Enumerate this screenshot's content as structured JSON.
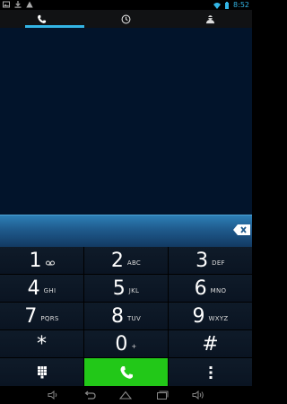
{
  "status_bar": {
    "time": "8:52",
    "left_icons": [
      "picture-icon",
      "download-icon",
      "warning-icon"
    ],
    "right_icons": [
      "wifi-icon",
      "battery-icon"
    ]
  },
  "tabs": [
    {
      "icon": "phone-icon",
      "active": true
    },
    {
      "icon": "clock-icon",
      "active": false
    },
    {
      "icon": "contacts-icon",
      "active": false
    }
  ],
  "number_field": {
    "value": ""
  },
  "keypad": [
    {
      "digit": "1",
      "letters": "",
      "voicemail": true
    },
    {
      "digit": "2",
      "letters": "ABC"
    },
    {
      "digit": "3",
      "letters": "DEF"
    },
    {
      "digit": "4",
      "letters": "GHI"
    },
    {
      "digit": "5",
      "letters": "JKL"
    },
    {
      "digit": "6",
      "letters": "MNO"
    },
    {
      "digit": "7",
      "letters": "PQRS"
    },
    {
      "digit": "8",
      "letters": "TUV"
    },
    {
      "digit": "9",
      "letters": "WXYZ"
    },
    {
      "digit": "*",
      "letters": ""
    },
    {
      "digit": "0",
      "letters": "+"
    },
    {
      "digit": "#",
      "letters": ""
    }
  ],
  "actions": [
    "dialpad-icon",
    "call-icon",
    "overflow-menu-icon"
  ],
  "colors": {
    "accent": "#33b5e5",
    "call_green": "#22c818",
    "background": "#02142b"
  }
}
